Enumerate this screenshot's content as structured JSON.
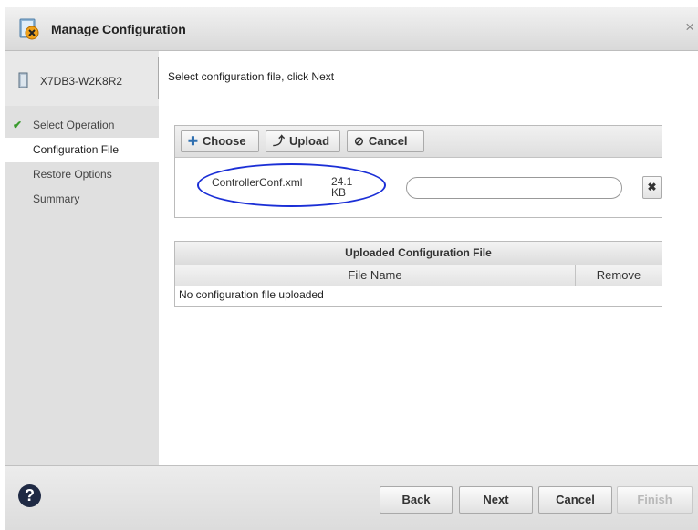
{
  "window": {
    "title": "Manage Configuration",
    "close_symbol": "×",
    "title_icon": "config-warning-icon"
  },
  "sidebar": {
    "device_name": "X7DB3-W2K8R2",
    "device_icon": "server-icon",
    "steps": [
      {
        "label": "Select Operation",
        "state": "completed"
      },
      {
        "label": "Configuration File",
        "state": "active"
      },
      {
        "label": "Restore Options",
        "state": "pending"
      },
      {
        "label": "Summary",
        "state": "pending"
      }
    ]
  },
  "main": {
    "instruction": "Select configuration file, click Next"
  },
  "upload": {
    "choose_label": "Choose",
    "upload_label": "Upload",
    "cancel_label": "Cancel",
    "file_name": "ControllerConf.xml",
    "file_size": "24.1 KB",
    "remove_symbol": "✖"
  },
  "uploaded_table": {
    "title": "Uploaded Configuration File",
    "columns": [
      "File Name",
      "Remove"
    ],
    "empty_message": "No configuration file uploaded"
  },
  "footer": {
    "back_label": "Back",
    "next_label": "Next",
    "cancel_label": "Cancel",
    "finish_label": "Finish",
    "help_symbol": "?"
  },
  "colors": {
    "highlight_ellipse": "#1b2fd6",
    "check_green": "#3a9b2e",
    "sidebar_bg": "#e0e0e0"
  }
}
